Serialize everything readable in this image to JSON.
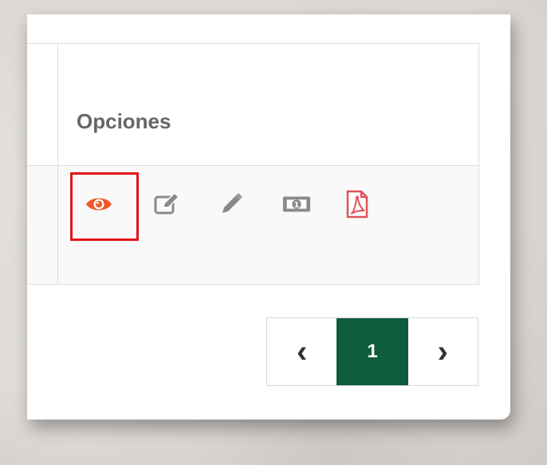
{
  "table": {
    "header": {
      "options_label": "Opciones"
    },
    "row": {
      "actions": [
        {
          "icon": "eye-icon",
          "color": "#f05a28"
        },
        {
          "icon": "edit-square-icon",
          "color": "#8a8a8a"
        },
        {
          "icon": "pencil-icon",
          "color": "#8a8a8a"
        },
        {
          "icon": "money-icon",
          "color": "#8a8a8a"
        },
        {
          "icon": "pdf-icon",
          "color": "#e0525a"
        }
      ]
    }
  },
  "pagination": {
    "prev_glyph": "‹",
    "current_page": "1",
    "next_glyph": "›",
    "active_color": "#0f5b3e"
  },
  "highlight": {
    "color": "#e3151a"
  }
}
